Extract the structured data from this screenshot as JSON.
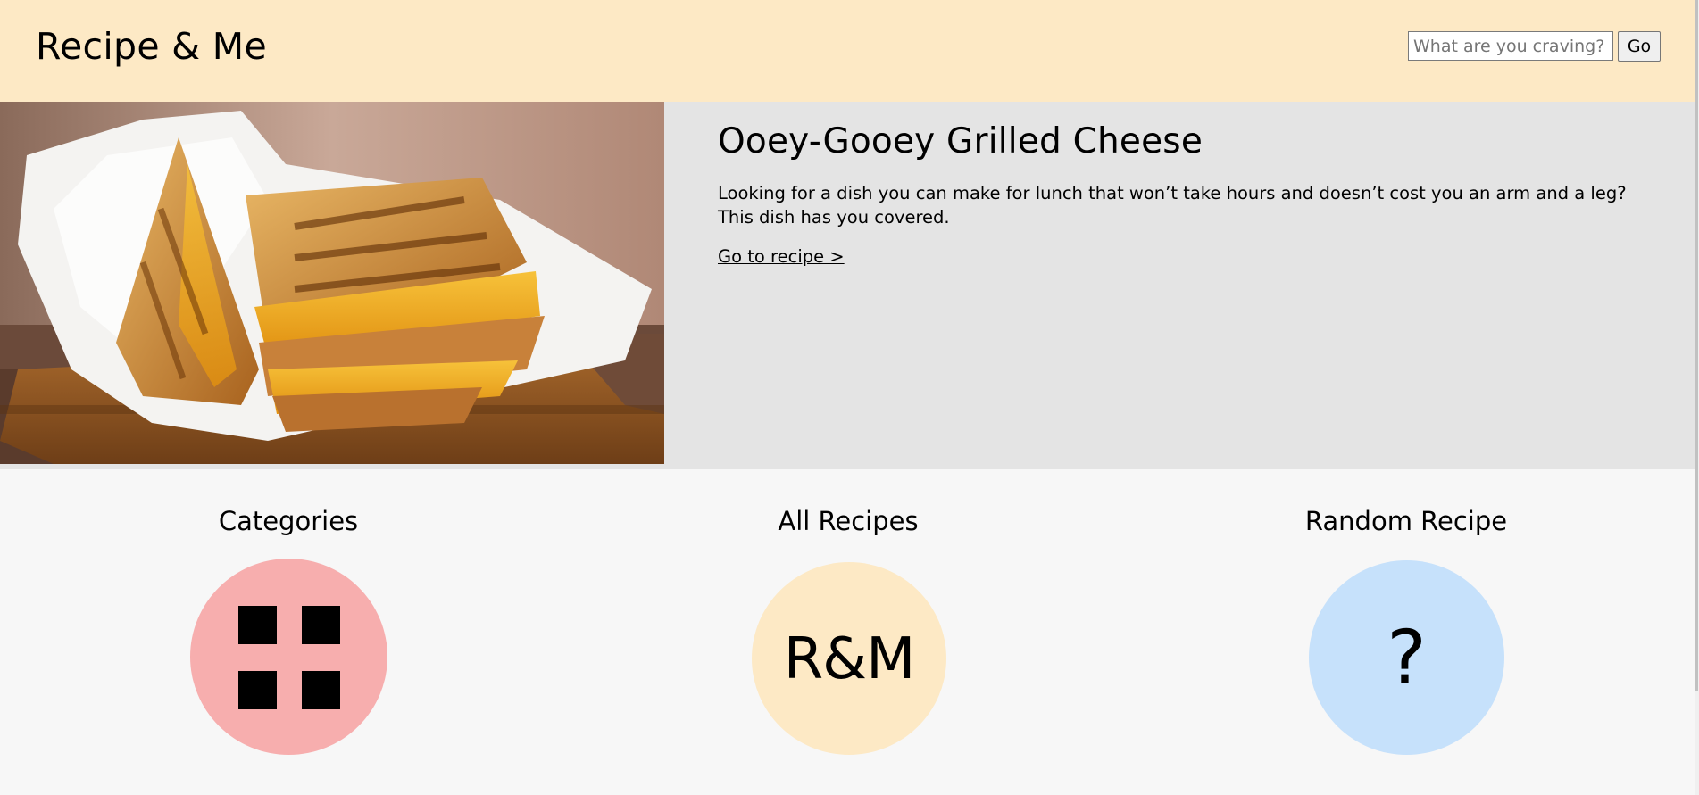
{
  "header": {
    "site_title": "Recipe & Me",
    "search": {
      "placeholder": "What are you craving?",
      "value": ""
    },
    "go_label": "Go"
  },
  "hero": {
    "title": "Ooey-Gooey Grilled Cheese",
    "description": "Looking for a dish you can make for lunch that won’t take hours and doesn’t cost you an arm and a leg? This dish has you covered.",
    "link_label": "Go to recipe >"
  },
  "nav": {
    "categories": {
      "label": "Categories",
      "icon": "grid-icon"
    },
    "all_recipes": {
      "label": "All Recipes",
      "icon_text": "R&M"
    },
    "random_recipe": {
      "label": "Random Recipe",
      "icon_text": "?"
    }
  },
  "colors": {
    "header_bg": "#fde9c5",
    "hero_bg": "#e4e4e4",
    "page_bg": "#f7f7f7",
    "categories_circle": "#f7aeae",
    "all_recipes_circle": "#fde9c5",
    "random_circle": "#c6e1fb"
  }
}
